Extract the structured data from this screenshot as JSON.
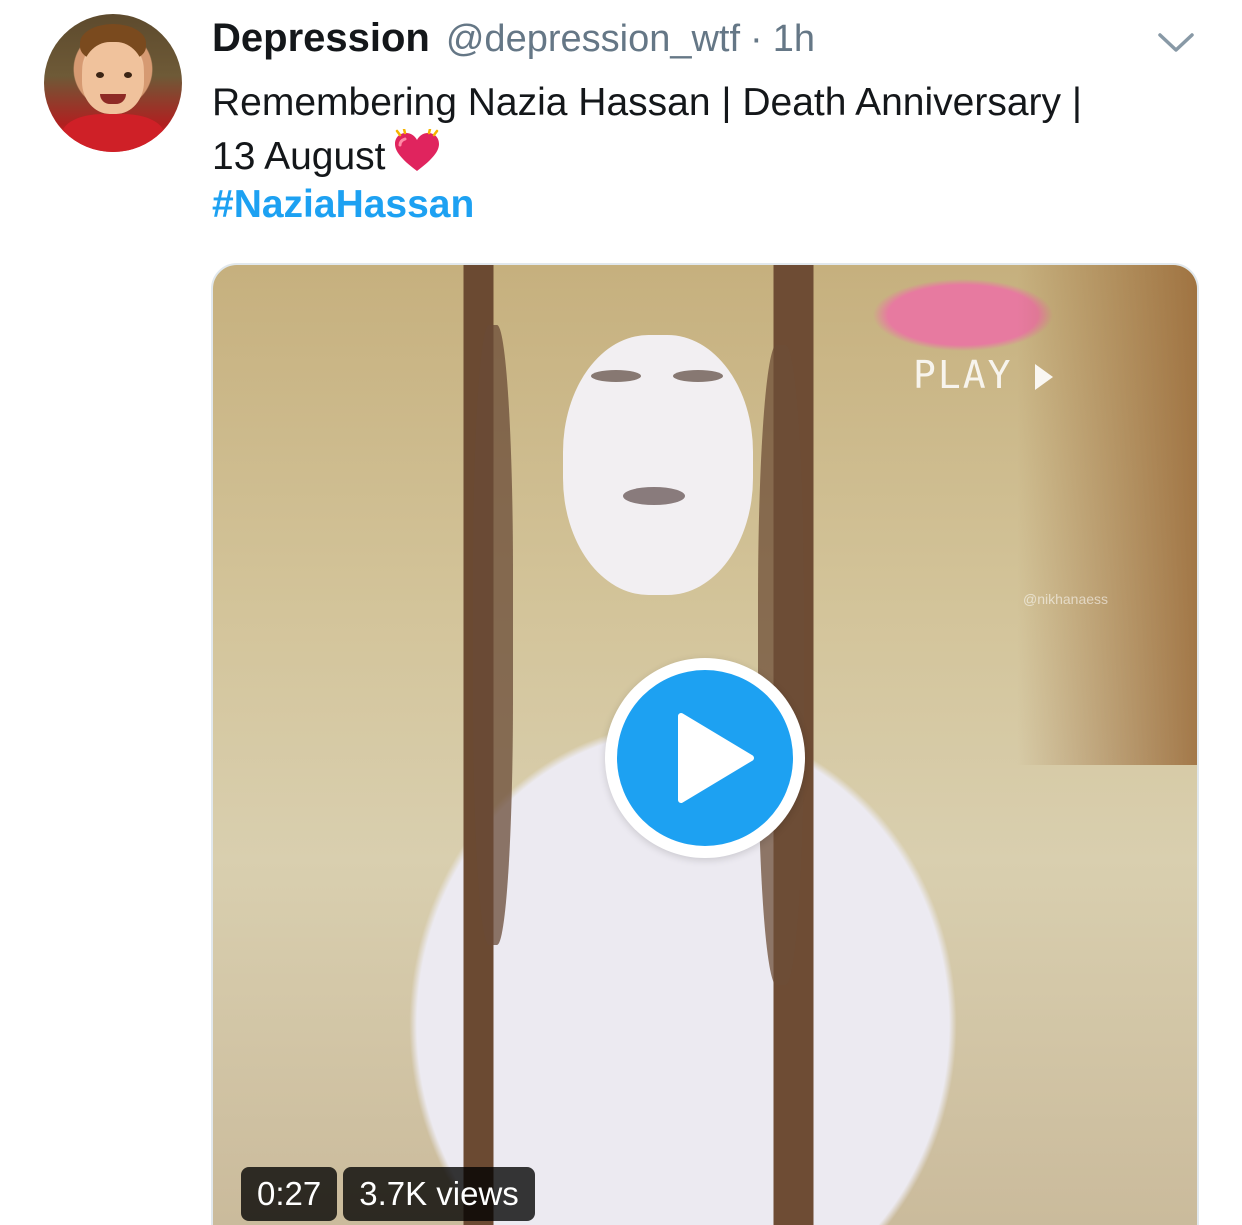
{
  "tweet": {
    "author_name": "Depression",
    "author_handle": "@depression_wtf",
    "separator": "·",
    "time": "1h",
    "text_line1": "Remembering Nazia Hassan | Death Anniversary |",
    "text_line2": "13 August",
    "hashtag": "#NaziaHassan"
  },
  "icons": {
    "caret": "chevron-down-icon",
    "heart": "beating-heart-emoji",
    "play": "play-icon"
  },
  "video": {
    "overlay_text": "PLAY",
    "watermark": "@nikhanaess",
    "duration": "0:27",
    "views": "3.7K views"
  },
  "colors": {
    "link": "#1da1f2",
    "secondary_text": "#657786",
    "primary_text": "#14171a",
    "badge_bg": "rgba(0,0,0,0.78)"
  }
}
